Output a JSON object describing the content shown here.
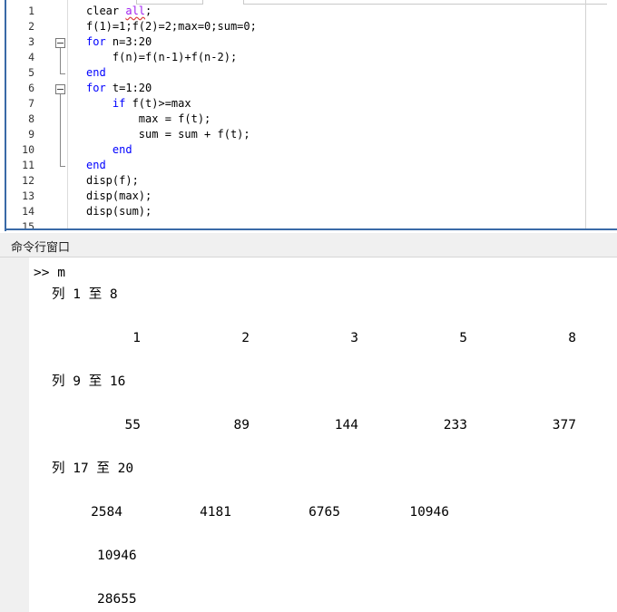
{
  "editor": {
    "lines": [
      {
        "n": "1",
        "code": [
          {
            "t": "clear "
          },
          {
            "t": "all",
            "c": "sq"
          },
          {
            "t": ";"
          }
        ]
      },
      {
        "n": "2",
        "code": [
          {
            "t": "f(1)=1;f(2)=2;max=0;sum=0;"
          }
        ]
      },
      {
        "n": "3",
        "code": [
          {
            "t": "for",
            "c": "kw"
          },
          {
            "t": " n=3:20"
          }
        ]
      },
      {
        "n": "4",
        "code": [
          {
            "t": "    f(n)=f(n-1)+f(n-2);"
          }
        ]
      },
      {
        "n": "5",
        "code": [
          {
            "t": "end",
            "c": "kw"
          }
        ]
      },
      {
        "n": "6",
        "code": [
          {
            "t": "for",
            "c": "kw"
          },
          {
            "t": " t=1:20"
          }
        ]
      },
      {
        "n": "7",
        "code": [
          {
            "t": "    "
          },
          {
            "t": "if",
            "c": "kw"
          },
          {
            "t": " f(t)>=max"
          }
        ]
      },
      {
        "n": "8",
        "code": [
          {
            "t": "        max = f(t);"
          }
        ]
      },
      {
        "n": "9",
        "code": [
          {
            "t": "        sum = sum + f(t);"
          }
        ]
      },
      {
        "n": "10",
        "code": [
          {
            "t": "    "
          },
          {
            "t": "end",
            "c": "kw"
          }
        ]
      },
      {
        "n": "11",
        "code": [
          {
            "t": "end",
            "c": "kw"
          }
        ]
      },
      {
        "n": "12",
        "code": [
          {
            "t": "disp(f);"
          }
        ]
      },
      {
        "n": "13",
        "code": [
          {
            "t": "disp(max);"
          }
        ]
      },
      {
        "n": "14",
        "code": [
          {
            "t": "disp(sum);"
          }
        ]
      },
      {
        "n": "15",
        "code": []
      }
    ]
  },
  "command_window": {
    "title": "命令行窗口",
    "prompt": ">> m",
    "blocks": [
      {
        "header": "列 1 至 8",
        "values": [
          "1",
          "2",
          "3",
          "5",
          "8"
        ]
      },
      {
        "header": "列 9 至 16",
        "values": [
          "55",
          "89",
          "144",
          "233",
          "377"
        ]
      },
      {
        "header": "列 17 至 20",
        "values": [
          "2584",
          "4181",
          "6765",
          "10946"
        ]
      }
    ],
    "max_value": "10946",
    "sum_value": "28655"
  }
}
